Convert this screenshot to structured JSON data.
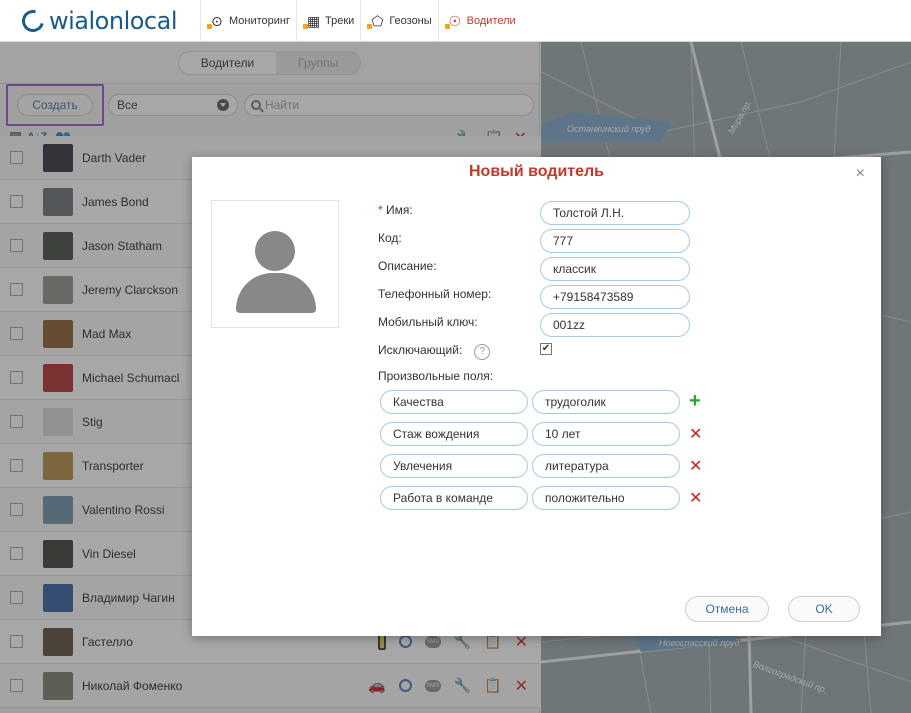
{
  "app": {
    "logo_text": "wialonlocal"
  },
  "nav": [
    {
      "label": "Мониторинг",
      "icon": "monitoring-icon",
      "glyph": "⊙"
    },
    {
      "label": "Треки",
      "icon": "tracks-icon",
      "glyph": "▦"
    },
    {
      "label": "Геозоны",
      "icon": "geofences-icon",
      "glyph": "⬠"
    },
    {
      "label": "Водители",
      "icon": "drivers-icon",
      "glyph": "☉"
    }
  ],
  "panel": {
    "tabs": {
      "drivers": "Водители",
      "groups": "Группы"
    },
    "create_label": "Создать",
    "filter_value": "Все",
    "search_placeholder": "Найти"
  },
  "drivers": [
    {
      "name": "Darth Vader",
      "color": "#2a2f3a"
    },
    {
      "name": "James Bond",
      "color": "#6b6f74"
    },
    {
      "name": "Jason Statham",
      "color": "#3e4a3c"
    },
    {
      "name": "Jeremy Clarckson",
      "color": "#8a8f85"
    },
    {
      "name": "Mad Max",
      "color": "#8a5a2e"
    },
    {
      "name": "Michael Schumacl",
      "color": "#b02a2a"
    },
    {
      "name": "Stig",
      "color": "#d8d8d8"
    },
    {
      "name": "Transporter",
      "color": "#b08a3e"
    },
    {
      "name": "Valentino Rossi",
      "color": "#6a8fa8"
    },
    {
      "name": "Vin Diesel",
      "color": "#3d3a34"
    },
    {
      "name": "Владимир Чагин",
      "color": "#2f5c9c"
    },
    {
      "name": "Гастелло",
      "color": "#5a4a3a"
    },
    {
      "name": "Николай Фоменко",
      "color": "#7a7a6e"
    }
  ],
  "map_labels": {
    "pond1": "Останкинский пруд",
    "pond2": "Новоспасский пруд",
    "street1": "Мира пр.",
    "street2": "Волгоградский пр."
  },
  "dialog": {
    "title": "Новый водитель",
    "close": "×",
    "fields": {
      "name_label": "Имя:",
      "name_value": "Толстой Л.Н.",
      "code_label": "Код:",
      "code_value": "777",
      "desc_label": "Описание:",
      "desc_value": "классик",
      "phone_label": "Телефонный номер:",
      "phone_value": "+79158473589",
      "key_label": "Мобильный ключ:",
      "key_value": "001zz",
      "exclusive_label": "Исключающий:",
      "custom_label": "Произвольные поля:"
    },
    "custom_fields": [
      {
        "name": "Качества",
        "value": "трудоголик"
      },
      {
        "name": "Стаж вождения",
        "value": "10 лет"
      },
      {
        "name": "Увлечения",
        "value": "литература"
      },
      {
        "name": "Работа в команде",
        "value": "положительно"
      }
    ],
    "cancel_label": "Отмена",
    "ok_label": "OK"
  }
}
